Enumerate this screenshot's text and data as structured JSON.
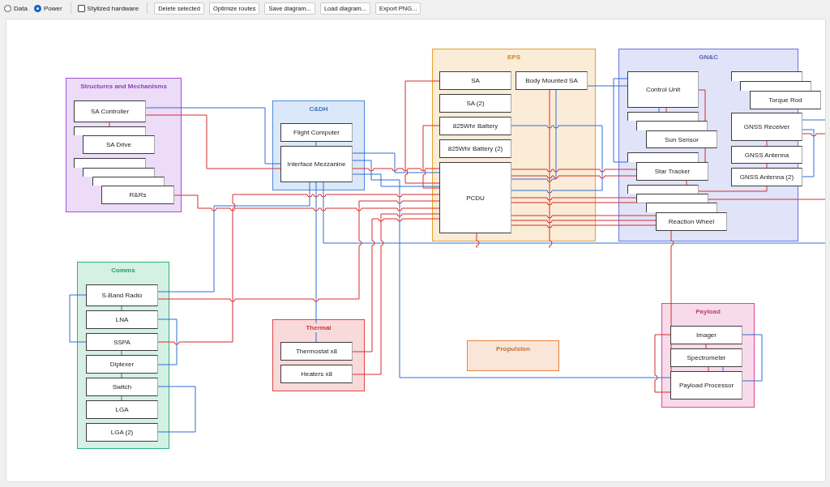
{
  "toolbar": {
    "layer_options": [
      {
        "label": "Data",
        "selected": false
      },
      {
        "label": "Power",
        "selected": true
      }
    ],
    "stylized_hardware": {
      "label": "Stylized hardware",
      "checked": false
    },
    "buttons": [
      "Delete selected",
      "Optimize routes",
      "Save diagram...",
      "Load diagram...",
      "Export PNG..."
    ]
  },
  "diagram": {
    "subsystems": [
      {
        "title": "Structures and Mechanisms",
        "color": "#a052d8",
        "components": [
          {
            "kind": "node",
            "label": "SA Controller"
          },
          {
            "kind": "covered"
          },
          {
            "kind": "node",
            "label": "SA Drive"
          },
          {
            "kind": "covered"
          },
          {
            "kind": "covered"
          },
          {
            "kind": "covered"
          },
          {
            "kind": "node",
            "label": "R&Rs"
          }
        ]
      },
      {
        "title": "C&DH",
        "color": "#4a8ae0",
        "components": [
          {
            "kind": "node",
            "label": "Flight Computer"
          },
          {
            "kind": "node",
            "label": "Interface Mezzanine"
          }
        ]
      },
      {
        "title": "EPS",
        "color": "#e8a030",
        "components": [
          {
            "kind": "node",
            "label": "SA"
          },
          {
            "kind": "node",
            "label": "Body Mounted SA"
          },
          {
            "kind": "node",
            "label": "SA (2)"
          },
          {
            "kind": "node",
            "label": "825Whr Battery"
          },
          {
            "kind": "node",
            "label": "825Whr Battery (2)"
          },
          {
            "kind": "node",
            "label": "PCDU"
          }
        ]
      },
      {
        "title": "GN&C",
        "color": "#6a72e0",
        "components": [
          {
            "kind": "node",
            "label": "Control Unit"
          },
          {
            "kind": "covered"
          },
          {
            "kind": "covered"
          },
          {
            "kind": "node",
            "label": "Sun Sensor"
          },
          {
            "kind": "covered"
          },
          {
            "kind": "node",
            "label": "Star Tracker"
          },
          {
            "kind": "covered"
          },
          {
            "kind": "covered"
          },
          {
            "kind": "covered"
          },
          {
            "kind": "node",
            "label": "Reaction Wheel"
          },
          {
            "kind": "covered"
          },
          {
            "kind": "covered"
          },
          {
            "kind": "node",
            "label": "Torque Rod"
          },
          {
            "kind": "node",
            "label": "GNSS Receiver"
          },
          {
            "kind": "node",
            "label": "GNSS Antenna"
          },
          {
            "kind": "node",
            "label": "GNSS Antenna (2)"
          }
        ]
      },
      {
        "title": "Comms",
        "color": "#2eb37a",
        "components": [
          {
            "kind": "node",
            "label": "S-Band Radio"
          },
          {
            "kind": "node",
            "label": "LNA"
          },
          {
            "kind": "node",
            "label": "SSPA"
          },
          {
            "kind": "node",
            "label": "Diplexer"
          },
          {
            "kind": "node",
            "label": "Switch"
          },
          {
            "kind": "node",
            "label": "LGA"
          },
          {
            "kind": "node",
            "label": "LGA (2)"
          }
        ]
      },
      {
        "title": "Thermal",
        "color": "#e04545",
        "components": [
          {
            "kind": "node",
            "label": "Thermostat x8"
          },
          {
            "kind": "node",
            "label": "Heaters x8"
          }
        ]
      },
      {
        "title": "Propulsion",
        "color": "#e8823a"
      },
      {
        "title": "Payload",
        "color": "#dd4a94",
        "components": [
          {
            "kind": "node",
            "label": "Imager"
          },
          {
            "kind": "node",
            "label": "Spectrometer"
          },
          {
            "kind": "node",
            "label": "Payload Processor"
          }
        ]
      }
    ]
  }
}
